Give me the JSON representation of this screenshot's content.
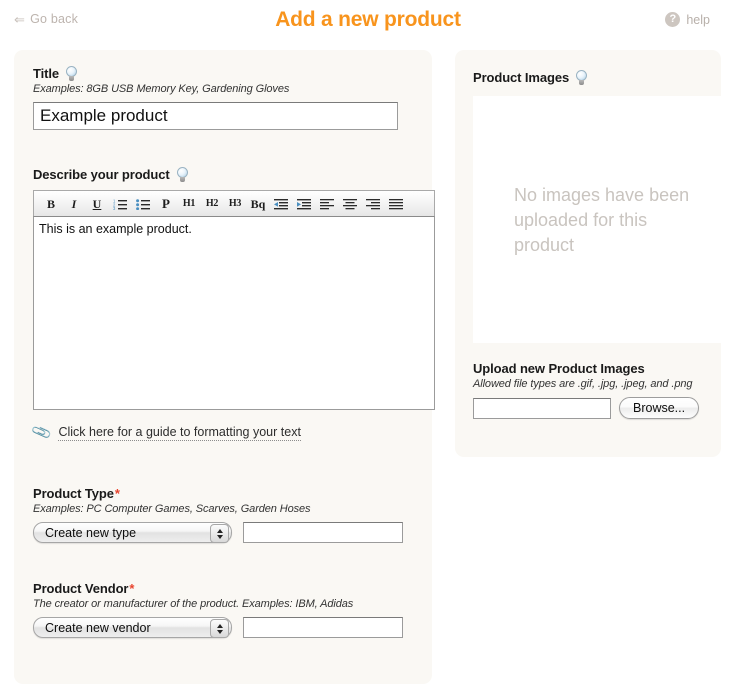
{
  "topbar": {
    "back_label": "Go back",
    "back_arrow": "⇐",
    "title": "Add a new product",
    "help_label": "help",
    "help_glyph": "?",
    "accent_color": "#f8941d"
  },
  "left": {
    "title_field": {
      "label": "Title",
      "hint": "Examples: 8GB USB Memory Key, Gardening Gloves",
      "value": "Example product",
      "placeholder": ""
    },
    "describe_field": {
      "label": "Describe your product",
      "value": "This is an example product.",
      "placeholder": "",
      "toolbar": [
        {
          "name": "bold",
          "glyph": "B"
        },
        {
          "name": "italic",
          "glyph": "I"
        },
        {
          "name": "underline",
          "glyph": "U"
        },
        {
          "name": "ordered-list",
          "glyph": ""
        },
        {
          "name": "unordered-list",
          "glyph": ""
        },
        {
          "name": "paragraph",
          "glyph": "P"
        },
        {
          "name": "heading-1",
          "glyph": "H1"
        },
        {
          "name": "heading-2",
          "glyph": "H2"
        },
        {
          "name": "heading-3",
          "glyph": "H3"
        },
        {
          "name": "blockquote",
          "glyph": "Bq"
        },
        {
          "name": "outdent",
          "glyph": ""
        },
        {
          "name": "indent",
          "glyph": ""
        },
        {
          "name": "align-left",
          "glyph": ""
        },
        {
          "name": "align-center",
          "glyph": ""
        },
        {
          "name": "align-right",
          "glyph": ""
        },
        {
          "name": "align-justify",
          "glyph": ""
        }
      ],
      "guide_link": "Click here for a guide to formatting your text"
    },
    "product_type": {
      "label": "Product Type",
      "required_mark": "*",
      "hint": "Examples: PC Computer Games, Scarves, Garden Hoses",
      "select_value": "Create new type",
      "text_value": "",
      "text_placeholder": ""
    },
    "product_vendor": {
      "label": "Product Vendor",
      "required_mark": "*",
      "hint": "The creator or manufacturer of the product. Examples: IBM, Adidas",
      "select_value": "Create new vendor",
      "text_value": "",
      "text_placeholder": ""
    }
  },
  "right": {
    "images_label": "Product Images",
    "empty_message": "No images have been uploaded for this product",
    "upload_label": "Upload new Product Images",
    "upload_hint": "Allowed file types are .gif, .jpg, .jpeg, and .png",
    "upload_value": "",
    "upload_placeholder": "",
    "browse_label": "Browse..."
  }
}
